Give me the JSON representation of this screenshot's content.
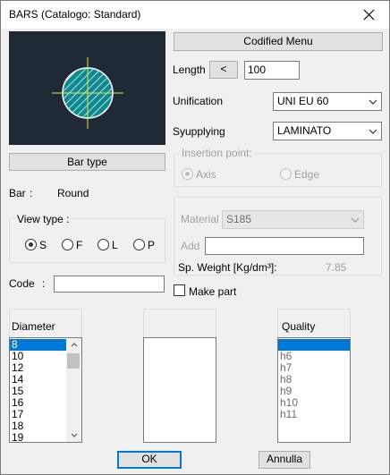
{
  "window": {
    "title": "BARS (Catalogo: Standard)"
  },
  "buttons": {
    "codified_menu": "Codified Menu",
    "bar_type": "Bar type",
    "length_arrow": "<",
    "ok": "OK",
    "cancel": "Annulla"
  },
  "length": {
    "label": "Length",
    "value": "100"
  },
  "unification": {
    "label": "Unification",
    "value": "UNI EU 60"
  },
  "supplying": {
    "label": "Syupplying",
    "value": "LAMINATO"
  },
  "insertion": {
    "title": "Insertion point:",
    "axis": "Axis",
    "edge": "Edge"
  },
  "bar_info": {
    "label": "Bar",
    "colon": ":",
    "value": "Round"
  },
  "view_type": {
    "title": "View type :",
    "s": "S",
    "f": "F",
    "l": "L",
    "p": "P"
  },
  "material": {
    "label": "Material",
    "value": "S185",
    "add_label": "Add",
    "add_value": ""
  },
  "weight": {
    "label": "Sp. Weight [Kg/dm³]:",
    "value": "7.85"
  },
  "code": {
    "label": "Code",
    "colon": ":",
    "value": ""
  },
  "make_part": {
    "label": "Make part"
  },
  "diameter": {
    "header": "Diameter",
    "items": [
      "8",
      "10",
      "12",
      "14",
      "15",
      "16",
      "17",
      "18",
      "19"
    ],
    "selected_index": 0
  },
  "middle_list": {
    "header": ""
  },
  "quality": {
    "header": "Quality",
    "items": [
      "",
      "h6",
      "h7",
      "h8",
      "h9",
      "h10",
      "h11"
    ],
    "selected_index": 0
  },
  "colors": {
    "selection": "#0078d7",
    "preview_bg": "#1f2a36",
    "bar_fill": "#0d8a8f",
    "axis": "#e8e84a"
  }
}
